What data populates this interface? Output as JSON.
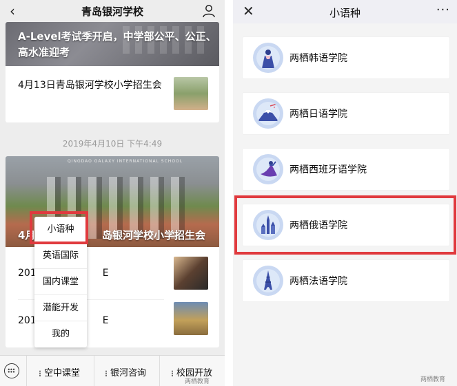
{
  "left": {
    "nav": {
      "back_glyph": "‹",
      "title": "青岛银河学校",
      "user_icon": "user-icon"
    },
    "card1": {
      "banner_title": "A-Level考试季开启，中学部公平、公正、高水准迎考",
      "item_text": "4月13日青岛银河学校小学招生会"
    },
    "timestamp": "2019年4月10日 下午4:49",
    "card2": {
      "photo_school_name": "QINGDAO GALAXY INTERNATIONAL SCHOOL",
      "photo_title_left": "4月",
      "photo_title_right": "岛银河学校小学招生会",
      "row1_text": "201",
      "row1_suffix": "E",
      "row2_text": "201",
      "row2_suffix": "E"
    },
    "popup_menu": [
      "小语种",
      "英语国际",
      "国内课堂",
      "潜能开发",
      "我的"
    ],
    "tabbar": {
      "tabs": [
        "空中课堂",
        "银河咨询",
        "校园开放"
      ],
      "keyboard_icon": "keyboard-icon"
    },
    "watermark": "两栖教育"
  },
  "right": {
    "nav": {
      "close_glyph": "✕",
      "title": "小语种",
      "more_glyph": "···"
    },
    "languages": [
      {
        "label": "两栖韩语学院",
        "icon": "korean-hanbok-icon"
      },
      {
        "label": "两栖日语学院",
        "icon": "mount-fuji-icon"
      },
      {
        "label": "两栖西班牙语学院",
        "icon": "flamenco-dancer-icon"
      },
      {
        "label": "两栖俄语学院",
        "icon": "kremlin-icon"
      },
      {
        "label": "两栖法语学院",
        "icon": "eiffel-tower-icon"
      }
    ],
    "watermark": "两栖教育"
  },
  "colors": {
    "highlight": "#e03a3e",
    "icon_bg": "#c9d8f2",
    "icon_accent": "#3b4fa8"
  }
}
